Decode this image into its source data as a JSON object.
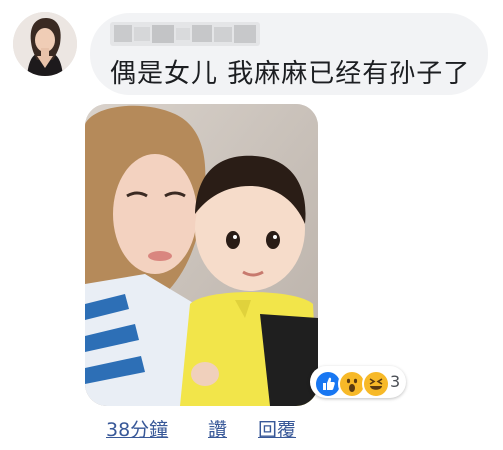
{
  "comment": {
    "text": "偶是女儿 我麻麻已经有孙子了"
  },
  "reactions": {
    "icons": [
      "like-icon",
      "wow-icon",
      "haha-icon"
    ],
    "count": "3",
    "colors": {
      "like": "#1877f2",
      "emoji": "#f7b928"
    }
  },
  "actions": {
    "time": "38分鐘",
    "like": "讚",
    "reply": "回覆"
  },
  "colors": {
    "bubble_bg": "#f2f3f5",
    "link": "#385898",
    "text": "#1c1e21"
  }
}
